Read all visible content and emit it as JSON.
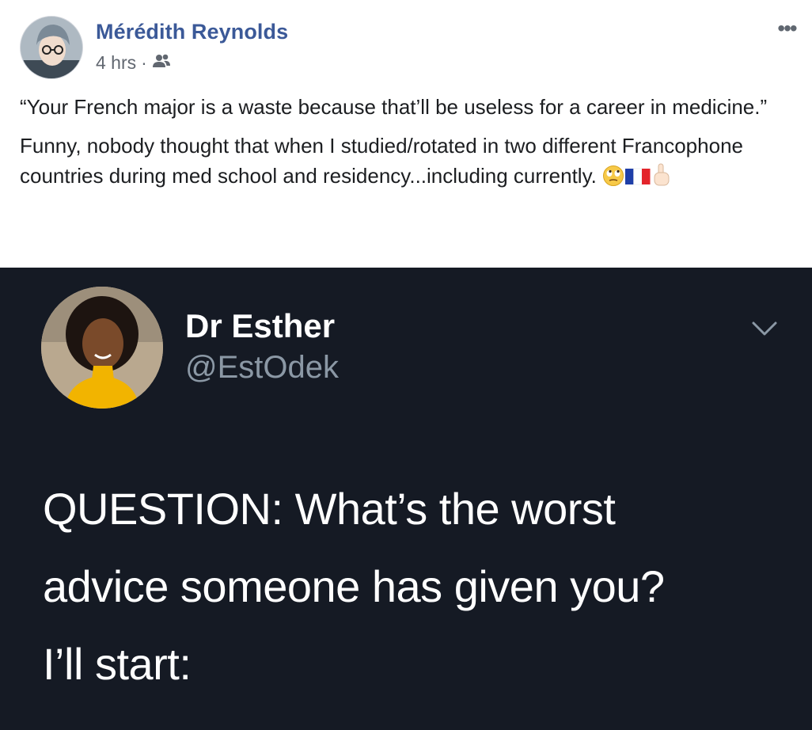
{
  "post": {
    "author": "Mérédith Reynolds",
    "time": "4 hrs",
    "separator": "·",
    "audience_icon": "friends-icon",
    "more_icon": "more-options-icon",
    "more_label": "•••",
    "paragraphs": [
      "“Your French major is a waste because that’ll be useless for a career in medicine.”",
      "Funny, nobody thought that when I studied/rotated in two different Francophone countries during med school and residency...including currently."
    ],
    "emojis": [
      "eye-roll-emoji",
      "france-flag-emoji",
      "pointing-up-emoji"
    ]
  },
  "tweet": {
    "name": "Dr Esther",
    "handle": "@EstOdek",
    "chevron_icon": "chevron-down-icon",
    "lines": [
      "QUESTION: What’s the worst",
      "advice someone has given you?",
      "I’ll start:"
    ]
  },
  "colors": {
    "author": "#3b5998",
    "meta": "#616770",
    "text": "#1c1e21",
    "tweet_bg": "#151a24",
    "tweet_handle": "#8b98a5"
  }
}
